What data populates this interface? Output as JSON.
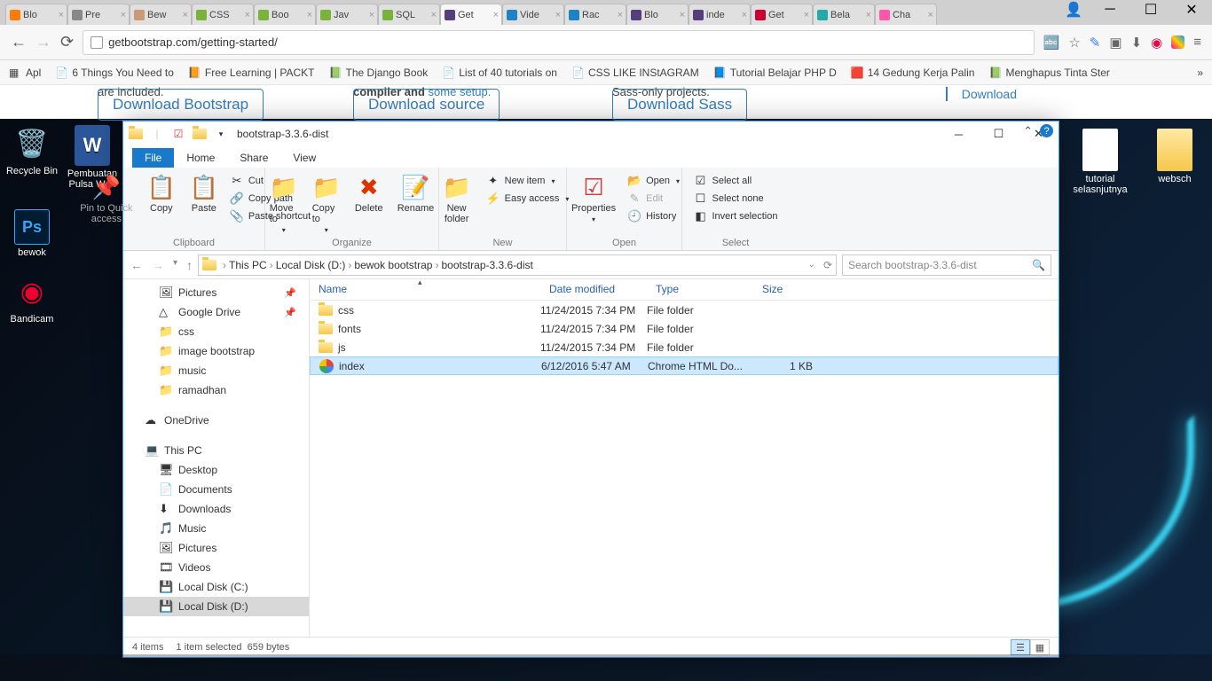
{
  "browser": {
    "tabs": [
      {
        "fav": "#ff7b00",
        "label": "Blo"
      },
      {
        "fav": "#888",
        "label": "Pre"
      },
      {
        "fav": "#c97",
        "label": "Bew"
      },
      {
        "fav": "#7ab33a",
        "label": "CSS"
      },
      {
        "fav": "#7ab33a",
        "label": "Boo"
      },
      {
        "fav": "#7ab33a",
        "label": "Jav"
      },
      {
        "fav": "#7ab33a",
        "label": "SQL"
      },
      {
        "fav": "#563d7c",
        "label": "Get",
        "active": true
      },
      {
        "fav": "#1c83c6",
        "label": "Vide"
      },
      {
        "fav": "#1c83c6",
        "label": "Rac"
      },
      {
        "fav": "#563d7c",
        "label": "Blo"
      },
      {
        "fav": "#563d7c",
        "label": "inde"
      },
      {
        "fav": "#c03",
        "label": "Get"
      },
      {
        "fav": "#2aa",
        "label": "Bela"
      },
      {
        "fav": "#f5a",
        "label": "Cha"
      }
    ],
    "url": "getbootstrap.com/getting-started/",
    "bookmarks": [
      "Apl",
      "6 Things You Need to",
      "Free Learning | PACKT",
      "The Django Book",
      "List of 40 tutorials on",
      "CSS LIKE INStAGRAM",
      "Tutorial Belajar PHP D",
      "14 Gedung Kerja Palin",
      "Menghapus Tinta Ster"
    ],
    "page": {
      "t1": "are included.",
      "t2": "compiler and",
      "t2link": "some setup.",
      "t3": "Sass-only projects.",
      "b1": "Download Bootstrap",
      "b2": "Download source",
      "b3": "Download Sass",
      "side": "Download"
    },
    "win": {
      "min": "─",
      "max": "☐",
      "close": "✕",
      "user": "👤"
    }
  },
  "desktop": {
    "icons": [
      {
        "name": "Recycle Bin",
        "glyph": "🗑"
      },
      {
        "name": "Pembuatan Pulsa We..",
        "glyph": "W"
      },
      {
        "name": "bewok",
        "glyph": "Ps"
      },
      {
        "name": "Bandicam",
        "glyph": "◉"
      }
    ],
    "icons_right": [
      {
        "name": "tutorial selasnjutnya",
        "glyph": "📄"
      },
      {
        "name": "websch",
        "glyph": "📁"
      }
    ]
  },
  "explorer": {
    "title": "bootstrap-3.3.6-dist",
    "tabs": {
      "file": "File",
      "home": "Home",
      "share": "Share",
      "view": "View"
    },
    "ribbon": {
      "pin": "Pin to Quick access",
      "copy": "Copy",
      "paste": "Paste",
      "cut": "Cut",
      "copypath": "Copy path",
      "pasteshortcut": "Paste shortcut",
      "moveto": "Move to",
      "copyto": "Copy to",
      "delete": "Delete",
      "rename": "Rename",
      "newfolder": "New folder",
      "newitem": "New item",
      "easyaccess": "Easy access",
      "properties": "Properties",
      "open": "Open",
      "edit": "Edit",
      "history": "History",
      "selectall": "Select all",
      "selectnone": "Select none",
      "invert": "Invert selection",
      "g_clipboard": "Clipboard",
      "g_organize": "Organize",
      "g_new": "New",
      "g_open": "Open",
      "g_select": "Select"
    },
    "breadcrumb": [
      "This PC",
      "Local Disk (D:)",
      "bewok bootstrap",
      "bootstrap-3.3.6-dist"
    ],
    "search_placeholder": "Search bootstrap-3.3.6-dist",
    "nav": [
      {
        "icon": "🖼",
        "label": "Pictures",
        "pin": true
      },
      {
        "icon": "△",
        "label": "Google Drive",
        "pin": true
      },
      {
        "icon": "📁",
        "label": "css"
      },
      {
        "icon": "📁",
        "label": "image bootstrap"
      },
      {
        "icon": "📁",
        "label": "music"
      },
      {
        "icon": "📁",
        "label": "ramadhan"
      },
      {
        "icon": "☁",
        "label": "OneDrive",
        "top": true
      },
      {
        "icon": "💻",
        "label": "This PC",
        "top": true
      },
      {
        "icon": "🖥",
        "label": "Desktop"
      },
      {
        "icon": "📄",
        "label": "Documents"
      },
      {
        "icon": "⬇",
        "label": "Downloads"
      },
      {
        "icon": "🎵",
        "label": "Music"
      },
      {
        "icon": "🖼",
        "label": "Pictures"
      },
      {
        "icon": "🎞",
        "label": "Videos"
      },
      {
        "icon": "💾",
        "label": "Local Disk (C:)"
      },
      {
        "icon": "💾",
        "label": "Local Disk (D:)",
        "sel": true
      }
    ],
    "cols": {
      "name": "Name",
      "date": "Date modified",
      "type": "Type",
      "size": "Size"
    },
    "rows": [
      {
        "icon": "folder",
        "name": "css",
        "date": "11/24/2015 7:34 PM",
        "type": "File folder",
        "size": ""
      },
      {
        "icon": "folder",
        "name": "fonts",
        "date": "11/24/2015 7:34 PM",
        "type": "File folder",
        "size": ""
      },
      {
        "icon": "folder",
        "name": "js",
        "date": "11/24/2015 7:34 PM",
        "type": "File folder",
        "size": ""
      },
      {
        "icon": "chrome",
        "name": "index",
        "date": "6/12/2016 5:47 AM",
        "type": "Chrome HTML Do...",
        "size": "1 KB",
        "sel": true
      }
    ],
    "status": {
      "items": "4 items",
      "sel": "1 item selected",
      "bytes": "659 bytes"
    }
  }
}
